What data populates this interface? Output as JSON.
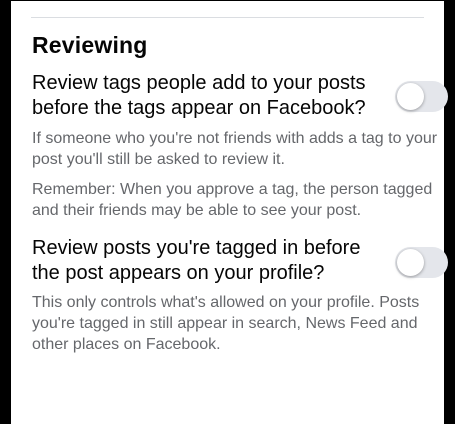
{
  "section": {
    "title": "Reviewing"
  },
  "settings": [
    {
      "title": "Review tags people add to your posts before the tags appear on Facebook?",
      "enabled": false,
      "descriptions": [
        "If someone who you're not friends with adds a tag to your post you'll still be asked to review it.",
        "Remember: When you approve a tag, the person tagged and their friends may be able to see your post."
      ]
    },
    {
      "title": "Review posts you're tagged in before the post appears on your profile?",
      "enabled": false,
      "descriptions": [
        "This only controls what's allowed on your profile. Posts you're tagged in still appear in search, News Feed and other places on Facebook."
      ]
    }
  ],
  "colors": {
    "text_primary": "#050505",
    "text_secondary": "#65676b",
    "toggle_off_track": "#e4e6eb",
    "divider": "#dadde1"
  }
}
